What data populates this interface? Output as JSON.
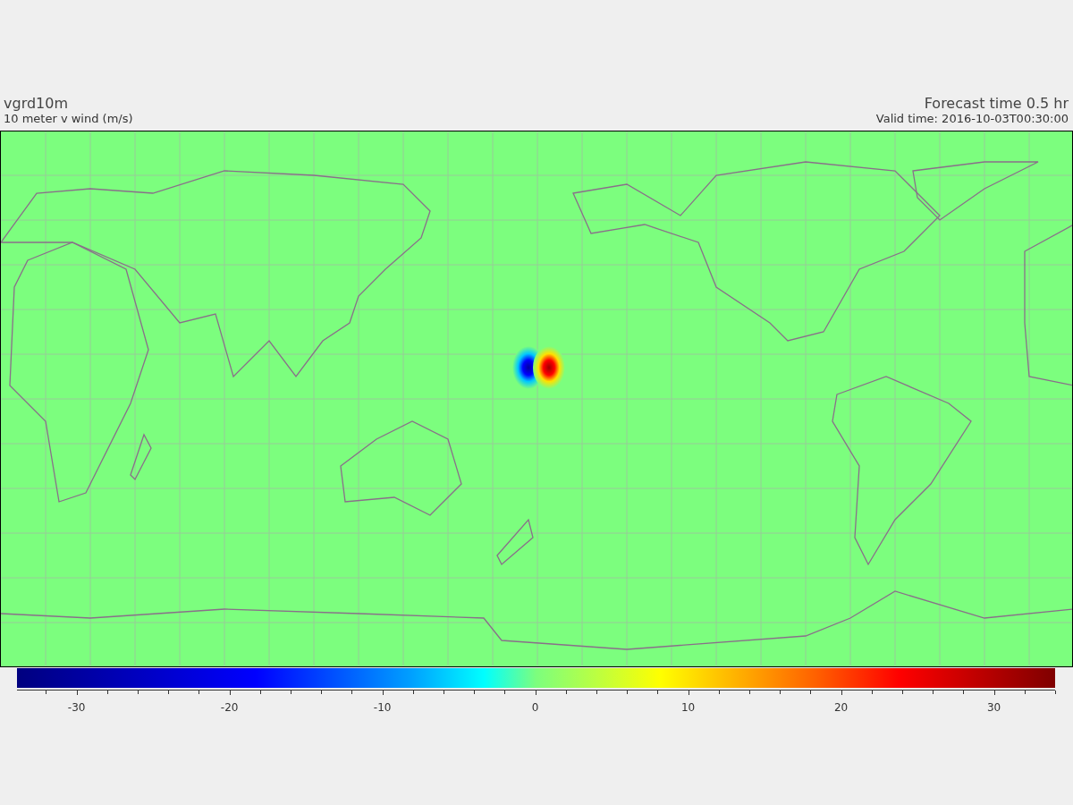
{
  "header": {
    "variable": "vgrd10m",
    "description": "10 meter v wind (m/s)",
    "forecast_time": "Forecast time 0.5 hr",
    "valid_time": "Valid time: 2016-10-03T00:30:00"
  },
  "colorbar": {
    "ticks": [
      "-30",
      "-20",
      "-10",
      "0",
      "10",
      "20",
      "30"
    ]
  }
}
